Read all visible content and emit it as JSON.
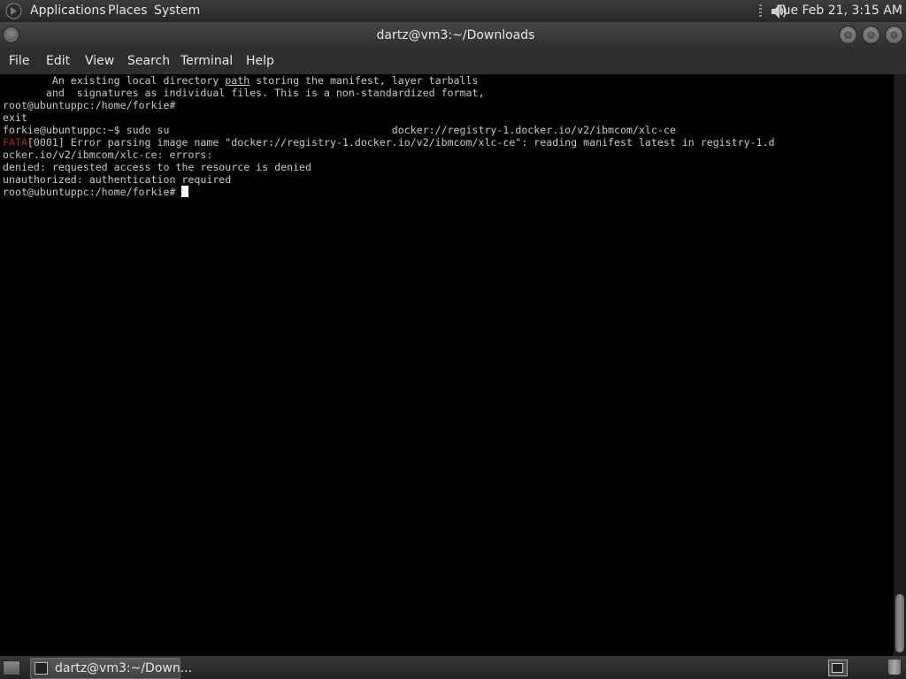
{
  "top_panel": {
    "menus": [
      "Applications",
      "Places",
      "System"
    ],
    "clock": "Tue Feb 21,  3:15 AM",
    "icons": {
      "logo": "gnome-foot-icon",
      "volume": "volume-icon"
    }
  },
  "window": {
    "title": "dartz@vm3:~/Downloads"
  },
  "menubar": {
    "items": [
      "File",
      "Edit",
      "View",
      "Search",
      "Terminal",
      "Help"
    ]
  },
  "terminal": {
    "lines": [
      {
        "pre": "        An existing local directory ",
        "ul": "path",
        "post": " storing the manifest, layer tarballs"
      },
      {
        "text": "       and  signatures as individual files. This is a non-standardized format,"
      },
      {
        "text": "root@ubuntuppc:/home/forkie#"
      },
      {
        "text": "exit"
      },
      {
        "text": "forkie@ubuntuppc:~$ sudo su                                    docker://registry-1.docker.io/v2/ibmcom/xlc-ce"
      },
      {
        "red": "FATA",
        "post": "[0001] Error parsing image name \"docker://registry-1.docker.io/v2/ibmcom/xlc-ce\": reading manifest latest in registry-1.d"
      },
      {
        "text": "ocker.io/v2/ibmcom/xlc-ce: errors:"
      },
      {
        "text": "denied: requested access to the resource is denied"
      },
      {
        "text": "unauthorized: authentication required"
      },
      {
        "text": "root@ubuntuppc:/home/forkie# "
      }
    ]
  },
  "bottom_panel": {
    "task_label": "dartz@vm3:~/Down..."
  }
}
